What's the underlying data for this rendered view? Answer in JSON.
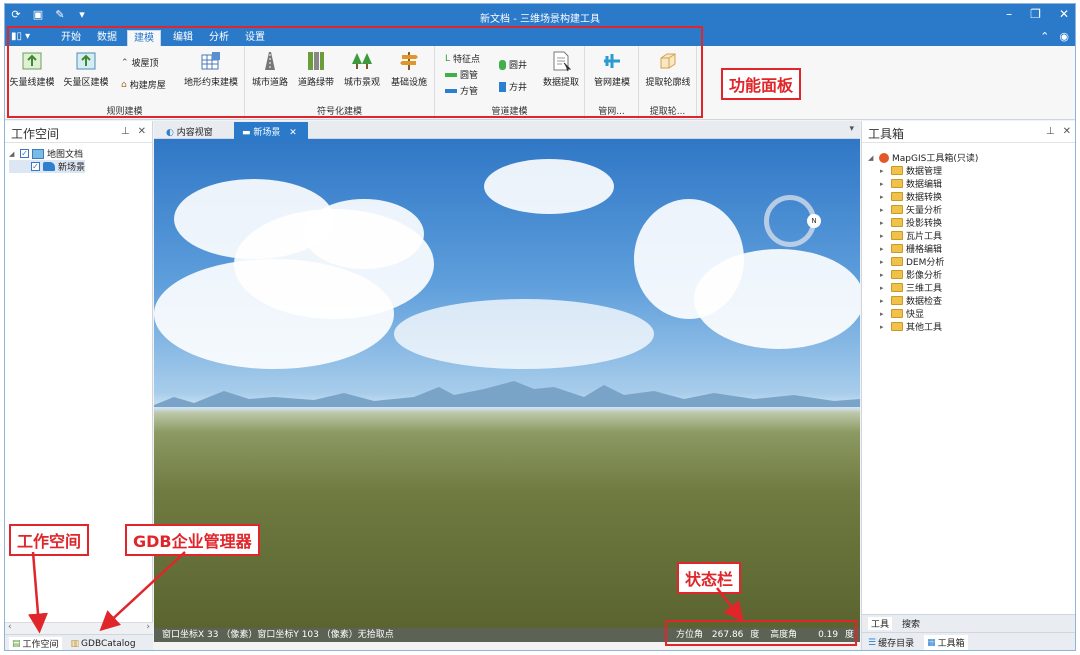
{
  "window": {
    "title": "新文档 - 三维场景构建工具",
    "controls": {
      "minimize": "–",
      "maximize": "❐",
      "close": "✕"
    }
  },
  "quick_access": {
    "app_icon": "refresh-icon",
    "save_icon": "save-icon",
    "undo_icon": "brush-icon",
    "more": "▾"
  },
  "ribbon_tabs": {
    "file_menu": "▮▯ ▾",
    "tabs": [
      "开始",
      "数据",
      "建模",
      "编辑",
      "分析",
      "设置"
    ],
    "active": "建模",
    "collapse": "⌃"
  },
  "ribbon": {
    "groups": [
      {
        "label": "规则建模",
        "buttons": [
          "矢量线建模",
          "矢量区建模"
        ],
        "small": [
          "坡屋顶",
          "构建房屋"
        ],
        "extra": "地形约束建模"
      },
      {
        "label": "符号化建模",
        "buttons": [
          "城市道路",
          "道路绿带",
          "城市景观",
          "基础设施"
        ]
      },
      {
        "label": "管道建模",
        "small": [
          "特征点",
          "圆管",
          "方管",
          "圆井",
          "方井"
        ],
        "buttons": [
          "数据提取"
        ]
      },
      {
        "label": "管网...",
        "buttons": [
          "管网建模"
        ]
      },
      {
        "label": "提取轮...",
        "buttons": [
          "提取轮廓线"
        ]
      }
    ]
  },
  "annotations": {
    "ribbon_panel": "功能面板",
    "workspace": "工作空间",
    "gdb": "GDB企业管理器",
    "statusbar": "状态栏"
  },
  "left_panel": {
    "title": "工作空间",
    "pin": "⊥",
    "close": "✕",
    "tree": [
      {
        "label": "地图文档",
        "level": 0
      },
      {
        "label": "新场景",
        "level": 1
      }
    ],
    "bottom_tabs": [
      "工作空间",
      "GDBCatalog"
    ]
  },
  "doc_tabs": {
    "tabs": [
      "内容视窗",
      "新场景"
    ],
    "active": "新场景",
    "close": "✕",
    "dropdown": "▾"
  },
  "status_bar": {
    "left": "窗口坐标X 33 （像素）窗口坐标Y 103 （像素）无拾取点",
    "azimuth_label": "方位角",
    "azimuth_value": "267.86",
    "azimuth_unit": "度",
    "elevation_label": "高度角",
    "elevation_value": "0.19",
    "elevation_unit": "度"
  },
  "right_panel": {
    "title": "工具箱",
    "pin": "⊥",
    "close": "✕",
    "root": "MapGIS工具箱(只读)",
    "items": [
      "数据管理",
      "数据编辑",
      "数据转换",
      "矢量分析",
      "投影转换",
      "瓦片工具",
      "栅格编辑",
      "DEM分析",
      "影像分析",
      "三维工具",
      "数据检查",
      "快显",
      "其他工具"
    ],
    "tabs1": [
      "工具",
      "搜索"
    ],
    "tabs2": [
      "缓存目录",
      "工具箱"
    ]
  },
  "colors": {
    "accent": "#2b79c9",
    "annotation_red": "#e0262b",
    "statusbar": "#5c6355"
  }
}
